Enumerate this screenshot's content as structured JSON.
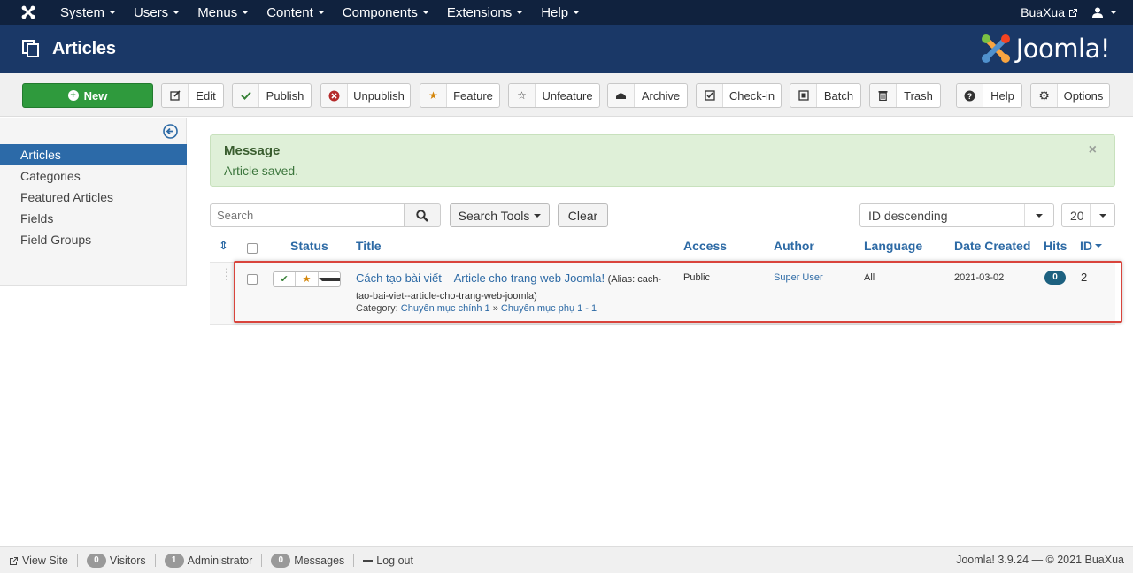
{
  "navbar": {
    "menu": [
      {
        "label": "System"
      },
      {
        "label": "Users"
      },
      {
        "label": "Menus"
      },
      {
        "label": "Content"
      },
      {
        "label": "Components"
      },
      {
        "label": "Extensions"
      },
      {
        "label": "Help"
      }
    ],
    "site_name": "BuaXua"
  },
  "header": {
    "title": "Articles",
    "logo_text": "Joomla!"
  },
  "toolbar": {
    "new_label": "New",
    "buttons": [
      {
        "label": "Edit",
        "icon": "edit-icon"
      },
      {
        "label": "Publish",
        "icon": "check-icon"
      },
      {
        "label": "Unpublish",
        "icon": "times-circle-icon"
      },
      {
        "label": "Feature",
        "icon": "star-icon"
      },
      {
        "label": "Unfeature",
        "icon": "star-outline-icon"
      },
      {
        "label": "Archive",
        "icon": "archive-icon"
      },
      {
        "label": "Check-in",
        "icon": "checkbox-icon"
      },
      {
        "label": "Batch",
        "icon": "square-icon"
      },
      {
        "label": "Trash",
        "icon": "trash-icon"
      },
      {
        "label": "Help",
        "icon": "question-icon"
      },
      {
        "label": "Options",
        "icon": "gear-icon"
      }
    ]
  },
  "sidebar": {
    "items": [
      {
        "label": "Articles",
        "active": true
      },
      {
        "label": "Categories"
      },
      {
        "label": "Featured Articles"
      },
      {
        "label": "Fields"
      },
      {
        "label": "Field Groups"
      }
    ]
  },
  "alert": {
    "title": "Message",
    "text": "Article saved.",
    "close": "×"
  },
  "filters": {
    "search_placeholder": "Search",
    "search_tools_label": "Search Tools",
    "clear_label": "Clear",
    "ordering": "ID descending",
    "limit": "20"
  },
  "table": {
    "headers": {
      "sort": "⇕",
      "status": "Status",
      "title": "Title",
      "access": "Access",
      "author": "Author",
      "language": "Language",
      "date_created": "Date Created",
      "hits": "Hits",
      "id": "ID"
    },
    "rows": [
      {
        "title": "Cách tạo bài viết – Article cho trang web Joomla!",
        "alias_line1": "(Alias: cach-",
        "alias_line2": "tao-bai-viet--article-cho-trang-web-joomla)",
        "category_label": "Category:",
        "category_parent": "Chuyên mục chính 1",
        "category_sep": "»",
        "category_child": "Chuyên mục phụ 1 - 1",
        "access": "Public",
        "author": "Super User",
        "language": "All",
        "date_created": "2021-03-02",
        "hits": "0",
        "id": "2"
      }
    ]
  },
  "footer": {
    "view_site": "View Site",
    "visitors_count": "0",
    "visitors_label": "Visitors",
    "admin_count": "1",
    "admin_label": "Administrator",
    "messages_count": "0",
    "messages_label": "Messages",
    "logout": "Log out",
    "version": "Joomla! 3.9.24 — © 2021 BuaXua"
  },
  "colors": {
    "navbar_bg": "#10223e",
    "header_bg": "#1a3867",
    "new_button": "#2f9a3d",
    "active_sidebar": "#2c6aa8",
    "alert_bg": "#dff0d8",
    "highlight_border": "#d9443c"
  }
}
